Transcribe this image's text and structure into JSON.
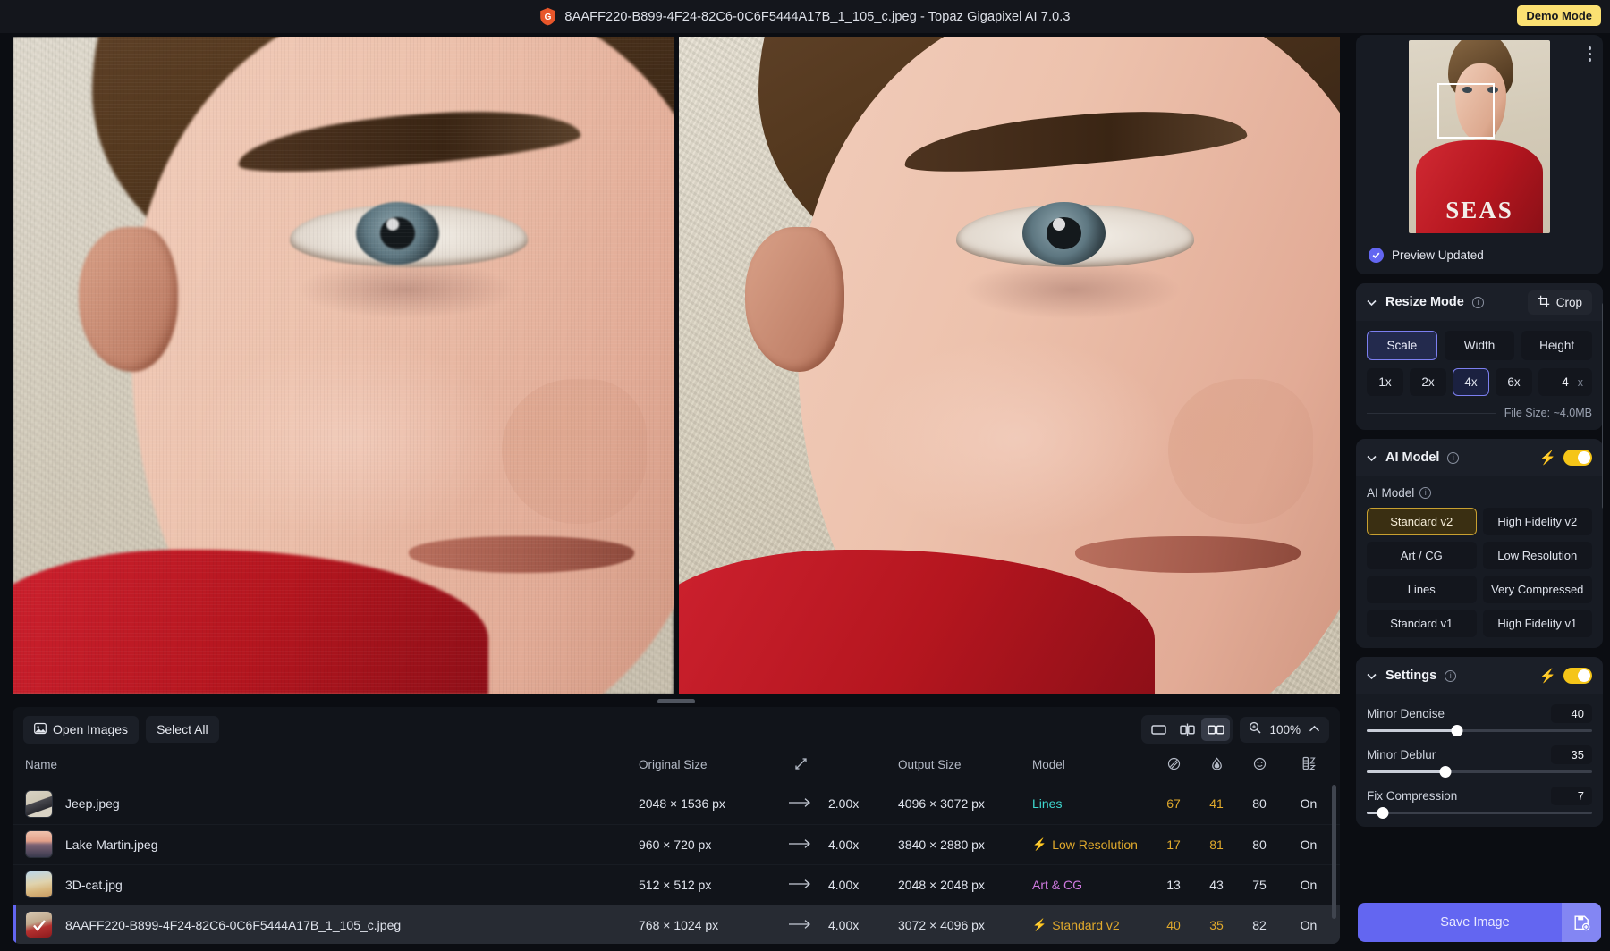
{
  "titlebar": {
    "logo_icon": "gigapixel-g-logo-icon",
    "title": "8AAFF220-B899-4F24-82C6-0C6F5444A17B_1_105_c.jpeg - Topaz Gigapixel AI 7.0.3",
    "demo_badge": "Demo Mode"
  },
  "preview_panel": {
    "shirt_text": "SEAS",
    "kebab_icon": "more-vertical-icon",
    "status_icon": "check-circle-icon",
    "status_text": "Preview Updated"
  },
  "resize_mode": {
    "title": "Resize Mode",
    "info_icon": "info-icon",
    "chevron_icon": "chevron-down-icon",
    "crop_icon": "crop-icon",
    "crop_label": "Crop",
    "modes": [
      "Scale",
      "Width",
      "Height"
    ],
    "active_mode": "Scale",
    "scales": [
      "1x",
      "2x",
      "4x",
      "6x"
    ],
    "active_scale": "4x",
    "custom_value": "4",
    "custom_unit": "x",
    "file_size": "File Size: ~4.0MB"
  },
  "ai_model": {
    "title": "AI Model",
    "info_icon": "info-icon",
    "chevron_icon": "chevron-down-icon",
    "bolt_icon": "lightning-bolt-icon",
    "toggle_on": true,
    "sublabel": "AI Model",
    "models": [
      "Standard v2",
      "High Fidelity v2",
      "Art / CG",
      "Low Resolution",
      "Lines",
      "Very Compressed",
      "Standard v1",
      "High Fidelity v1"
    ],
    "active_model": "Standard v2"
  },
  "settings": {
    "title": "Settings",
    "info_icon": "info-icon",
    "chevron_icon": "chevron-down-icon",
    "bolt_icon": "lightning-bolt-icon",
    "toggle_on": true,
    "sliders": [
      {
        "label": "Minor Denoise",
        "value": "40",
        "percent": 40
      },
      {
        "label": "Minor Deblur",
        "value": "35",
        "percent": 35
      },
      {
        "label": "Fix Compression",
        "value": "7",
        "percent": 7
      }
    ]
  },
  "save": {
    "label": "Save Image",
    "icon": "save-file-icon"
  },
  "filebar": {
    "open_images_label": "Open Images",
    "open_images_icon": "image-icon",
    "select_all_label": "Select All",
    "view_modes": [
      {
        "name": "single-view-icon",
        "active": false
      },
      {
        "name": "split-view-icon",
        "active": false
      },
      {
        "name": "side-by-side-view-icon",
        "active": true
      }
    ],
    "zoom_icon": "magnifier-icon",
    "zoom_value": "100%",
    "collapse_icon": "chevron-up-icon"
  },
  "table": {
    "headers": {
      "name": "Name",
      "original_size": "Original Size",
      "arrow_icon": "resize-arrow-icon",
      "output_size": "Output Size",
      "model": "Model",
      "denoise_icon": "denoise-circle-icon",
      "deblur_icon": "water-drop-icon",
      "face_icon": "face-smiley-icon",
      "compression_icon": "compression-icon",
      "trash_icon": "trash-icon"
    },
    "rows": [
      {
        "thumb": "t-jeep",
        "name": "Jeep.jpeg",
        "original_size": "2048 × 1536 px",
        "scale": "2.00x",
        "output_size": "4096 × 3072 px",
        "model": "Lines",
        "model_color": "#3fd8d0",
        "model_bolt": false,
        "denoise": "67",
        "denoise_color": "#e0a92c",
        "deblur": "41",
        "deblur_color": "#e0a92c",
        "face": "80",
        "face_color": "#dfe3ec",
        "compression": "On",
        "selected": false
      },
      {
        "thumb": "t-lake",
        "name": "Lake Martin.jpeg",
        "original_size": "960 × 720 px",
        "scale": "4.00x",
        "output_size": "3840 × 2880 px",
        "model": "Low Resolution",
        "model_color": "#e0a92c",
        "model_bolt": true,
        "denoise": "17",
        "denoise_color": "#e0a92c",
        "deblur": "81",
        "deblur_color": "#e0a92c",
        "face": "80",
        "face_color": "#dfe3ec",
        "compression": "On",
        "selected": false
      },
      {
        "thumb": "t-cat",
        "name": "3D-cat.jpg",
        "original_size": "512 × 512 px",
        "scale": "4.00x",
        "output_size": "2048 × 2048 px",
        "model": "Art & CG",
        "model_color": "#d07ae0",
        "model_bolt": false,
        "denoise": "13",
        "denoise_color": "#dfe3ec",
        "deblur": "43",
        "deblur_color": "#dfe3ec",
        "face": "75",
        "face_color": "#dfe3ec",
        "compression": "On",
        "selected": false
      },
      {
        "thumb": "t-boy",
        "name": "8AAFF220-B899-4F24-82C6-0C6F5444A17B_1_105_c.jpeg",
        "original_size": "768 × 1024 px",
        "scale": "4.00x",
        "output_size": "3072 × 4096 px",
        "model": "Standard v2",
        "model_color": "#e0a92c",
        "model_bolt": true,
        "denoise": "40",
        "denoise_color": "#e0a92c",
        "deblur": "35",
        "deblur_color": "#e0a92c",
        "face": "82",
        "face_color": "#dfe3ec",
        "compression": "On",
        "selected": true
      }
    ]
  }
}
